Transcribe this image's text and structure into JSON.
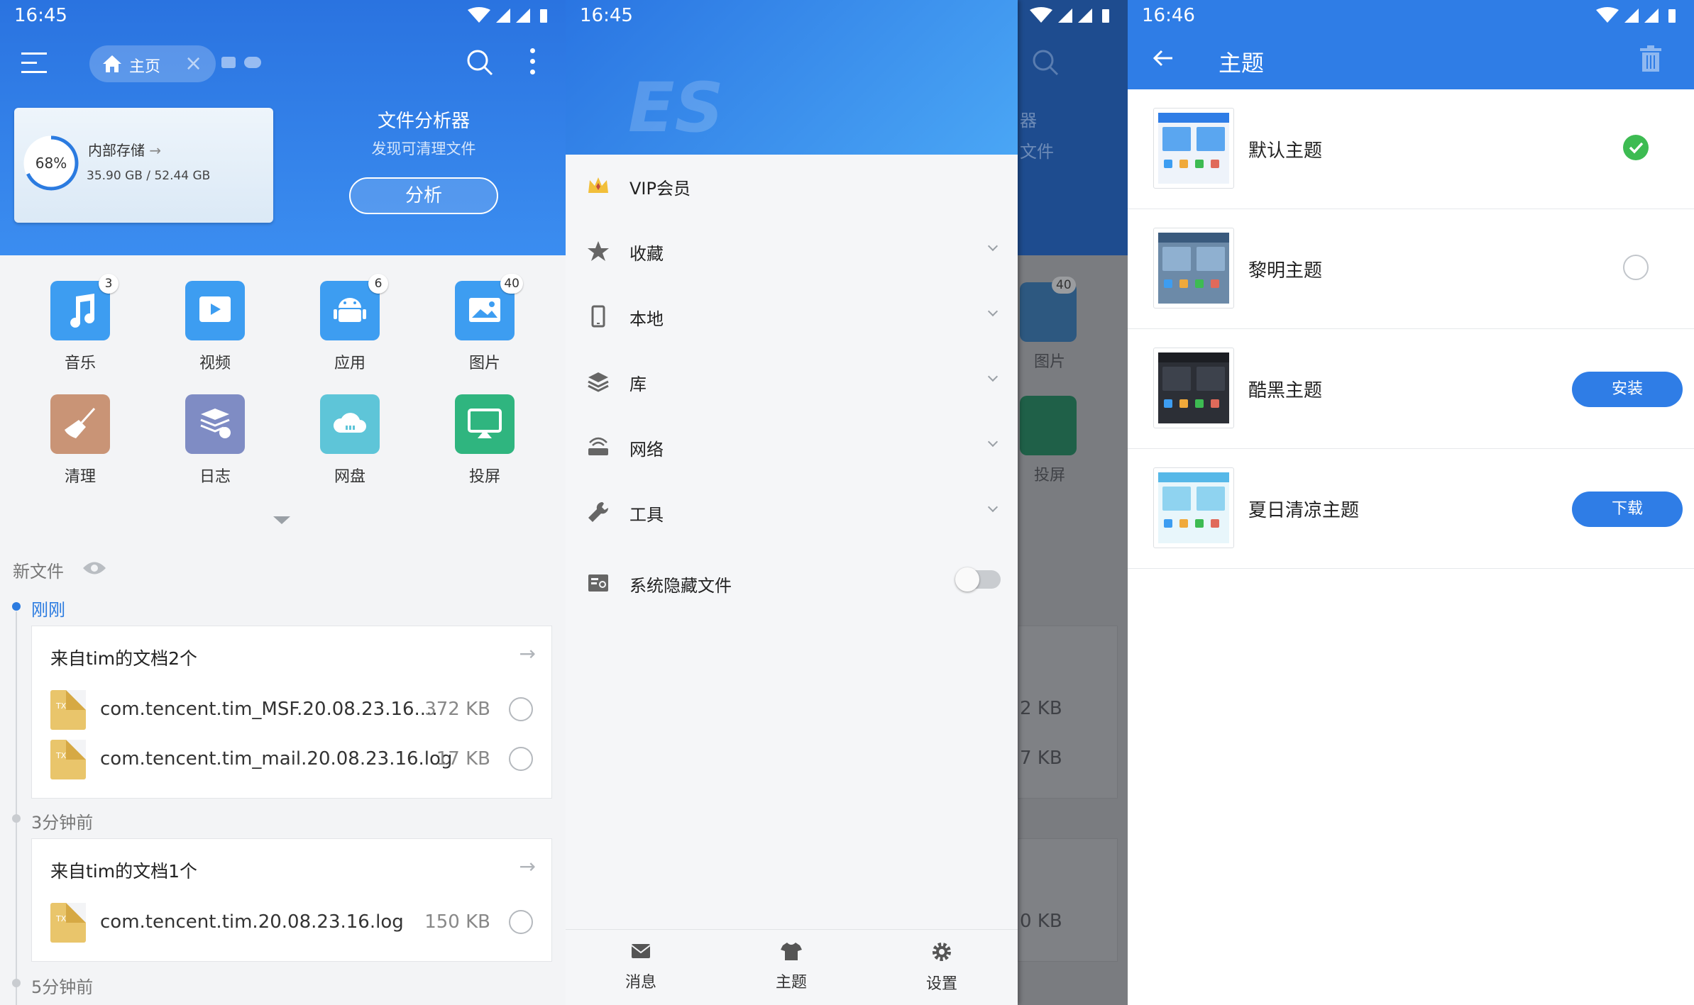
{
  "screens": {
    "home": {
      "status": {
        "time": "16:45"
      },
      "tab": {
        "label": "主页"
      },
      "storage": {
        "percent": "68%",
        "percent_value": 0.68,
        "name": "内部存储",
        "size": "35.90 GB / 52.44 GB"
      },
      "analyzer": {
        "title": "文件分析器",
        "subtitle": "发现可清理文件",
        "button": "分析"
      },
      "categories": [
        {
          "label": "音乐",
          "badge": "3",
          "color": "#3d9df1",
          "icon": "music-icon"
        },
        {
          "label": "视频",
          "badge": "",
          "color": "#3d9df1",
          "icon": "video-icon"
        },
        {
          "label": "应用",
          "badge": "6",
          "color": "#3d9df1",
          "icon": "android-icon"
        },
        {
          "label": "图片",
          "badge": "40",
          "color": "#3d9df1",
          "icon": "picture-icon"
        },
        {
          "label": "清理",
          "badge": "",
          "color": "#c99476",
          "icon": "broom-icon"
        },
        {
          "label": "日志",
          "badge": "",
          "color": "#7f8cc4",
          "icon": "log-icon"
        },
        {
          "label": "网盘",
          "badge": "",
          "color": "#5ec5d8",
          "icon": "cloud-icon"
        },
        {
          "label": "投屏",
          "badge": "",
          "color": "#2fb57f",
          "icon": "cast-icon"
        }
      ],
      "new_files": {
        "title": "新文件"
      },
      "groups": [
        {
          "time": "刚刚",
          "card_title": "来自tim的文档2个",
          "files": [
            {
              "name": "com.tencent.tim_MSF.20.08.23.16....",
              "size": "372 KB"
            },
            {
              "name": "com.tencent.tim_mail.20.08.23.16.log",
              "size": "17 KB"
            }
          ]
        },
        {
          "time": "3分钟前",
          "card_title": "来自tim的文档1个",
          "files": [
            {
              "name": "com.tencent.tim.20.08.23.16.log",
              "size": "150 KB"
            }
          ]
        },
        {
          "time": "5分钟前"
        }
      ],
      "file_icon_text": "TXT"
    },
    "drawer": {
      "status": {
        "time": "16:45"
      },
      "items": [
        {
          "label": "VIP会员",
          "icon": "crown-icon"
        },
        {
          "label": "收藏",
          "icon": "star-icon"
        },
        {
          "label": "本地",
          "icon": "phone-icon"
        },
        {
          "label": "库",
          "icon": "layers-icon"
        },
        {
          "label": "网络",
          "icon": "router-icon"
        },
        {
          "label": "工具",
          "icon": "wrench-icon"
        },
        {
          "label": "系统隐藏文件",
          "icon": "hidden-file-icon"
        }
      ],
      "bottom": [
        {
          "label": "消息",
          "icon": "mail-icon"
        },
        {
          "label": "主题",
          "icon": "shirt-icon"
        },
        {
          "label": "设置",
          "icon": "gear-icon"
        }
      ],
      "behind": {
        "badge": "40",
        "pictures": "图片",
        "cast": "投屏",
        "size1": "2 KB",
        "size2": "7 KB",
        "size3": "0 KB",
        "head1": "器",
        "head2": "文件"
      }
    },
    "themes": {
      "status": {
        "time": "16:46"
      },
      "title": "主题",
      "items": [
        {
          "name": "默认主题",
          "state": "selected"
        },
        {
          "name": "黎明主题",
          "state": "radio"
        },
        {
          "name": "酷黑主题",
          "state": "button",
          "button": "安装"
        },
        {
          "name": "夏日清凉主题",
          "state": "button",
          "button": "下载"
        }
      ]
    }
  }
}
